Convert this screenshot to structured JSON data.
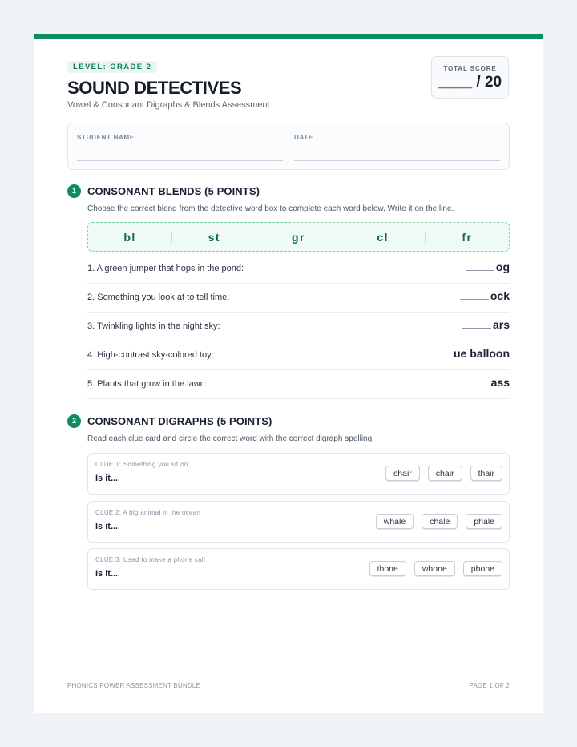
{
  "header": {
    "level_badge": "LEVEL: GRADE 2",
    "title": "SOUND DETECTIVES",
    "subtitle": "Vowel & Consonant Digraphs & Blends Assessment"
  },
  "score": {
    "label": "TOTAL SCORE",
    "value": "____ / 20"
  },
  "student": {
    "name_label": "STUDENT NAME",
    "date_label": "DATE"
  },
  "section1": {
    "number": "1",
    "title": "CONSONANT BLENDS (5 POINTS)",
    "instructions": "Choose the correct blend from the detective word box to complete each word below. Write it on the line.",
    "word_box": [
      "bl",
      "st",
      "gr",
      "cl",
      "fr"
    ],
    "questions": [
      {
        "text": "1. A green jumper that hops in the pond:",
        "ending": "og"
      },
      {
        "text": "2. Something you look at to tell time:",
        "ending": "ock"
      },
      {
        "text": "3. Twinkling lights in the night sky:",
        "ending": "ars"
      },
      {
        "text": "4. High-contrast sky-colored toy:",
        "ending": "ue balloon"
      },
      {
        "text": "5. Plants that grow in the lawn:",
        "ending": "ass"
      }
    ]
  },
  "section2": {
    "number": "2",
    "title": "CONSONANT DIGRAPHS (5 POINTS)",
    "instructions": "Read each clue card and circle the correct word with the correct digraph spelling.",
    "clues": [
      {
        "label": "CLUE 1: Something you sit on",
        "prompt": "Is it...",
        "choices": [
          "shair",
          "chair",
          "thair"
        ]
      },
      {
        "label": "CLUE 2: A big animal in the ocean",
        "prompt": "Is it...",
        "choices": [
          "whale",
          "chale",
          "phale"
        ]
      },
      {
        "label": "CLUE 3: Used to make a phone call",
        "prompt": "Is it...",
        "choices": [
          "thone",
          "whone",
          "phone"
        ]
      }
    ]
  },
  "footer": {
    "left": "PHONICS POWER ASSESSMENT BUNDLE",
    "right": "PAGE 1 OF 2"
  },
  "colors": {
    "accent": "#0c8f5f",
    "word_box_bg": "#f0faf4"
  }
}
